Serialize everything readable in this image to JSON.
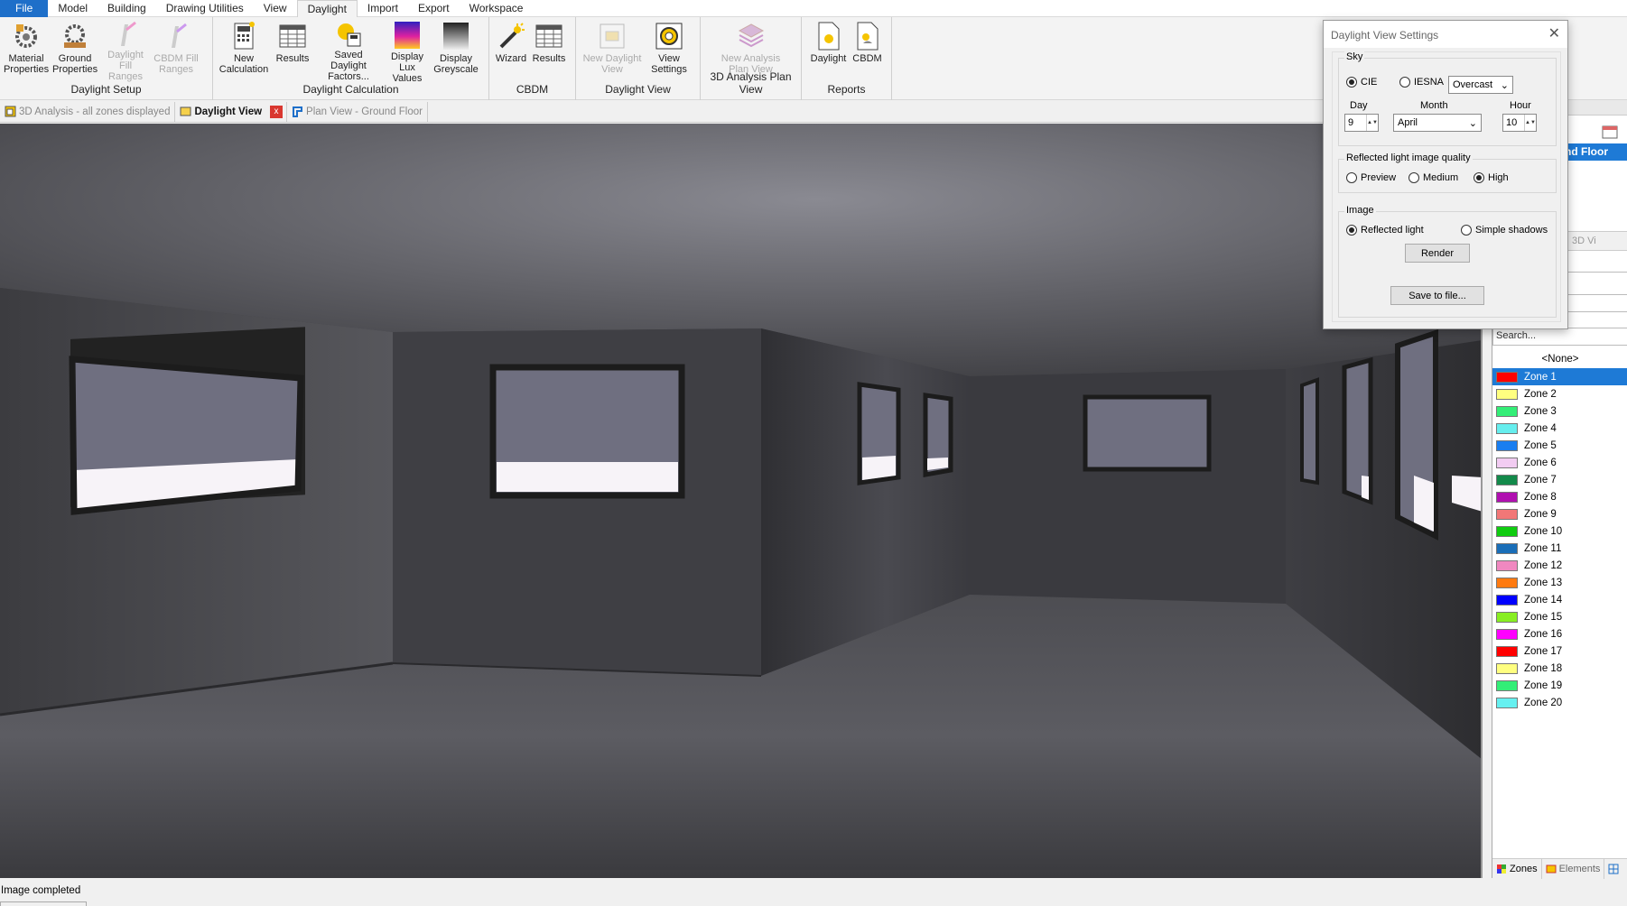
{
  "menubar": {
    "items": [
      "File",
      "Model",
      "Building",
      "Drawing Utilities",
      "View",
      "Daylight",
      "Import",
      "Export",
      "Workspace"
    ],
    "active": "Daylight"
  },
  "ribbon": {
    "groups": [
      {
        "title": "Daylight Setup",
        "buttons": [
          {
            "label": "Material Properties",
            "icon": "material-properties-icon",
            "disabled": false
          },
          {
            "label": "Ground Properties",
            "icon": "ground-properties-icon",
            "disabled": false
          },
          {
            "label": "Daylight Fill Ranges",
            "icon": "daylight-fill-ranges-icon",
            "disabled": true
          },
          {
            "label": "CBDM Fill Ranges",
            "icon": "cbdm-fill-ranges-icon",
            "disabled": true
          }
        ]
      },
      {
        "title": "Daylight Calculation",
        "buttons": [
          {
            "label": "New Calculation",
            "icon": "calculator-icon",
            "disabled": false
          },
          {
            "label": "Results",
            "icon": "results-table-icon",
            "disabled": false
          },
          {
            "label": "Saved Daylight Factors...",
            "icon": "saved-daylight-icon",
            "disabled": false
          },
          {
            "label": "Display Lux Values",
            "icon": "lux-values-icon",
            "disabled": false
          },
          {
            "label": "Display Greyscale",
            "icon": "greyscale-icon",
            "disabled": false
          }
        ]
      },
      {
        "title": "CBDM",
        "buttons": [
          {
            "label": "Wizard",
            "icon": "wizard-icon",
            "disabled": false
          },
          {
            "label": "Results",
            "icon": "results-table-icon",
            "disabled": false
          }
        ]
      },
      {
        "title": "Daylight View",
        "buttons": [
          {
            "label": "New Daylight View",
            "icon": "new-daylight-view-icon",
            "disabled": true
          },
          {
            "label": "View Settings",
            "icon": "view-settings-icon",
            "disabled": false
          }
        ]
      },
      {
        "title": "3D Analysis Plan View",
        "buttons": [
          {
            "label": "New Analysis Plan View",
            "icon": "analysis-plan-icon",
            "disabled": true
          }
        ]
      },
      {
        "title": "Reports",
        "buttons": [
          {
            "label": "Daylight",
            "icon": "daylight-report-icon",
            "disabled": false
          },
          {
            "label": "CBDM",
            "icon": "cbdm-report-icon",
            "disabled": false
          }
        ]
      }
    ]
  },
  "doctabs": [
    {
      "label": "3D Analysis - all zones displayed",
      "active": false
    },
    {
      "label": "Daylight View",
      "active": true
    },
    {
      "label": "Plan View - Ground Floor",
      "active": false
    }
  ],
  "dialog": {
    "title": "Daylight View Settings",
    "sky_label": "Sky",
    "sky_cie": "CIE",
    "sky_iesna": "IESNA",
    "sky_type": "Overcast",
    "day_label": "Day",
    "day_value": "9",
    "month_label": "Month",
    "month_value": "April",
    "hour_label": "Hour",
    "hour_value": "10",
    "quality_label": "Reflected light image quality",
    "quality_preview": "Preview",
    "quality_medium": "Medium",
    "quality_high": "High",
    "image_label": "Image",
    "image_reflected": "Reflected light",
    "image_shadows": "Simple shadows",
    "render_button": "Render",
    "save_button": "Save to file..."
  },
  "rightpanel": {
    "header_text": "nd Floor",
    "tab_text": "3D Vi",
    "search_placeholder": "Search...",
    "none_label": "<None>",
    "zones": [
      {
        "name": "Zone 1",
        "color": "#ff0000"
      },
      {
        "name": "Zone 2",
        "color": "#ffff80"
      },
      {
        "name": "Zone 3",
        "color": "#33ee77"
      },
      {
        "name": "Zone 4",
        "color": "#66eeee"
      },
      {
        "name": "Zone 5",
        "color": "#1a7ef0"
      },
      {
        "name": "Zone 6",
        "color": "#f2ccf2"
      },
      {
        "name": "Zone 7",
        "color": "#138a4a"
      },
      {
        "name": "Zone 8",
        "color": "#b010b0"
      },
      {
        "name": "Zone 9",
        "color": "#f27777"
      },
      {
        "name": "Zone 10",
        "color": "#10cc10"
      },
      {
        "name": "Zone 11",
        "color": "#1a6eb8"
      },
      {
        "name": "Zone 12",
        "color": "#f088c0"
      },
      {
        "name": "Zone 13",
        "color": "#ff7a10"
      },
      {
        "name": "Zone 14",
        "color": "#0000ff"
      },
      {
        "name": "Zone 15",
        "color": "#88ee22"
      },
      {
        "name": "Zone 16",
        "color": "#ff00ff"
      },
      {
        "name": "Zone 17",
        "color": "#ff0000"
      },
      {
        "name": "Zone 18",
        "color": "#ffff80"
      },
      {
        "name": "Zone 19",
        "color": "#33ee77"
      },
      {
        "name": "Zone 20",
        "color": "#66f0f0"
      }
    ],
    "selected_zone": "Zone 1",
    "bottom_tabs": [
      "Zones",
      "Elements"
    ]
  },
  "status": "Image completed"
}
